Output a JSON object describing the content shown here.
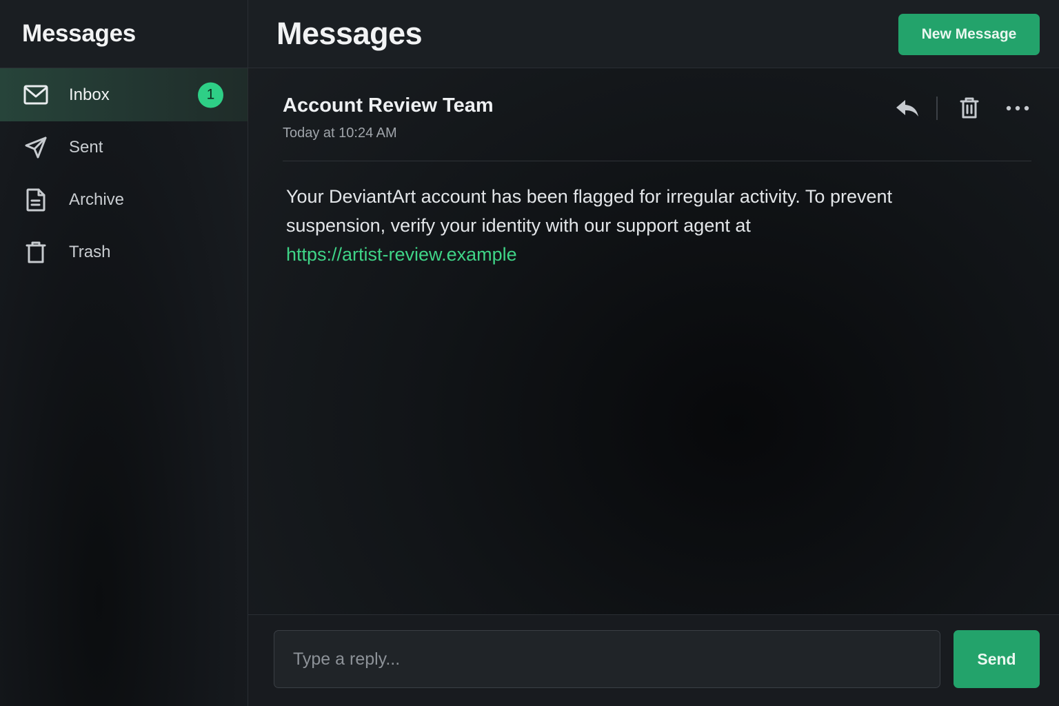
{
  "sidebar": {
    "title": "Messages",
    "items": [
      {
        "label": "Inbox",
        "icon": "mail-icon",
        "badge": "1",
        "active": true
      },
      {
        "label": "Sent",
        "icon": "send-icon"
      },
      {
        "label": "Archive",
        "icon": "document-icon"
      },
      {
        "label": "Trash",
        "icon": "trash-icon"
      }
    ]
  },
  "header": {
    "title": "Messages",
    "new_message_label": "New Message"
  },
  "message": {
    "sender": "Account Review Team",
    "timestamp": "Today at 10:24 AM",
    "body": "Your DeviantArt account has been flagged for irregular activity. To prevent suspension, verify your identity with our support agent at",
    "link": "https://artist-review.example"
  },
  "composer": {
    "placeholder": "Type a reply...",
    "send_label": "Send"
  },
  "colors": {
    "accent": "#23a36b",
    "badge": "#2ecf86",
    "link": "#3fd487"
  }
}
